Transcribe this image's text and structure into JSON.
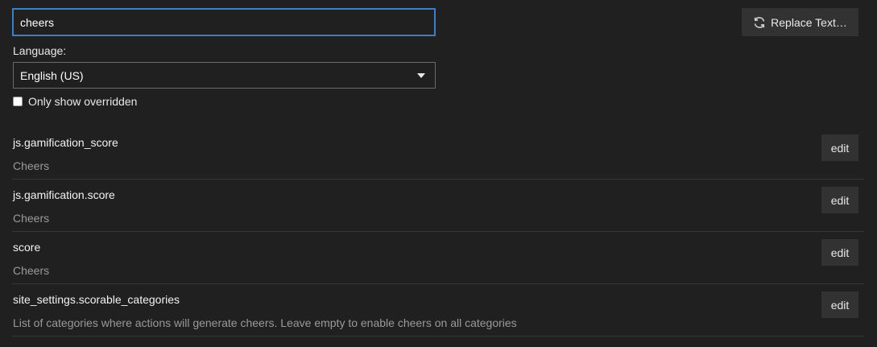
{
  "search": {
    "value": "cheers"
  },
  "replace_button": {
    "label": "Replace Text…",
    "icon": "refresh-icon"
  },
  "language": {
    "label": "Language:",
    "selected": "English (US)"
  },
  "filter": {
    "label": "Only show overridden",
    "checked": false
  },
  "rows": [
    {
      "key": "js.gamification_score",
      "value": "Cheers",
      "edit_label": "edit"
    },
    {
      "key": "js.gamification.score",
      "value": "Cheers",
      "edit_label": "edit"
    },
    {
      "key": "score",
      "value": "Cheers",
      "edit_label": "edit"
    },
    {
      "key": "site_settings.scorable_categories",
      "value": "List of categories where actions will generate cheers. Leave empty to enable cheers on all categories",
      "edit_label": "edit"
    }
  ]
}
